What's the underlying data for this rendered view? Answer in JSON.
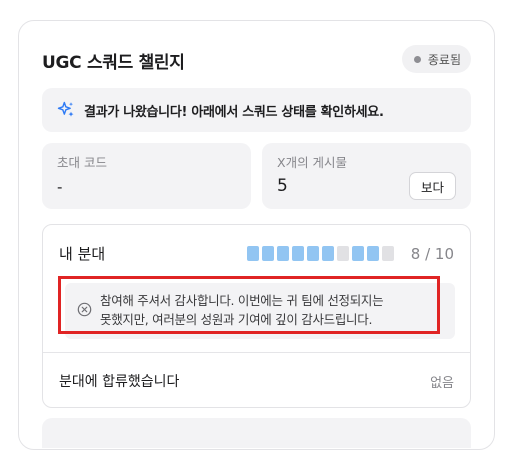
{
  "card": {
    "title": "UGC 스쿼드 챌린지",
    "status_label": "종료됨"
  },
  "banner": {
    "icon": "sparkle-icon",
    "text": "결과가 나왔습니다! 아래에서 스쿼드 상태를 확인하세요."
  },
  "invite": {
    "label": "초대 코드",
    "value": "-"
  },
  "posts": {
    "label": "X개의 게시물",
    "value": "5",
    "view_button": "보다"
  },
  "squad": {
    "title": "내 분대",
    "progress_text": "8 / 10",
    "filled": 8,
    "total": 10,
    "segment_pattern": [
      1,
      1,
      1,
      1,
      1,
      1,
      0,
      1,
      1,
      0
    ],
    "message_icon": "x-circle-icon",
    "message_line1": "참여해 주셔서 감사합니다. 이번에는 귀 팀에 선정되지는",
    "message_line2": "못했지만, 여러분의 성원과 기여에 깊이 감사드립니다.",
    "joined_label": "분대에 합류했습니다",
    "joined_value": "없음"
  },
  "colors": {
    "segment_on": "#92c5f2",
    "segment_off": "#e1e1e4",
    "highlight": "#e02424",
    "status_dot": "#8e8e93"
  }
}
